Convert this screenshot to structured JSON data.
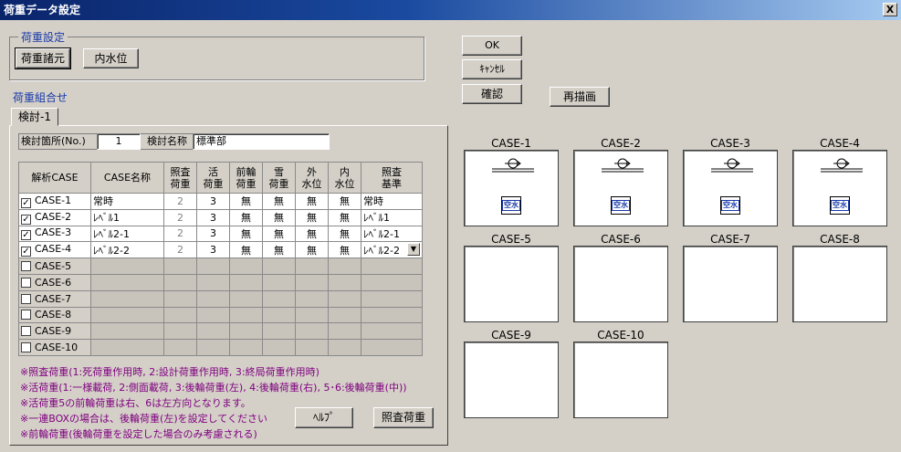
{
  "window": {
    "title": "荷重データ設定",
    "close_label": "X"
  },
  "load_settings": {
    "group_label": "荷重設定",
    "load_specs_button": "荷重諸元",
    "inner_water_button": "内水位"
  },
  "actions": {
    "ok": "OK",
    "cancel": "ｷｬﾝｾﾙ",
    "confirm": "確認",
    "redraw": "再描画",
    "help": "ﾍﾙﾌﾟ",
    "check_load": "照査荷重"
  },
  "combo_label": "荷重組合せ",
  "tab": {
    "label": "検討-1"
  },
  "location": {
    "label": "検討箇所(No.)",
    "value": "1",
    "name_label": "検討名称",
    "name_value": "標準部"
  },
  "grid": {
    "headers": [
      "解析CASE",
      "CASE名称",
      "照査\n荷重",
      "活\n荷重",
      "前輪\n荷重",
      "雪\n荷重",
      "外\n水位",
      "内\n水位",
      "照査\n基準"
    ],
    "rows": [
      {
        "checked": "✓",
        "case": "CASE-1",
        "name": "常時",
        "check_load": "2",
        "live": "3",
        "front": "無",
        "snow": "無",
        "outer": "無",
        "inner": "無",
        "criteria": "常時"
      },
      {
        "checked": "✓",
        "case": "CASE-2",
        "name": "ﾚﾍﾞﾙ1",
        "check_load": "2",
        "live": "3",
        "front": "無",
        "snow": "無",
        "outer": "無",
        "inner": "無",
        "criteria": "ﾚﾍﾞﾙ1"
      },
      {
        "checked": "✓",
        "case": "CASE-3",
        "name": "ﾚﾍﾞﾙ2-1",
        "check_load": "2",
        "live": "3",
        "front": "無",
        "snow": "無",
        "outer": "無",
        "inner": "無",
        "criteria": "ﾚﾍﾞﾙ2-1"
      },
      {
        "checked": "✓",
        "case": "CASE-4",
        "name": "ﾚﾍﾞﾙ2-2",
        "check_load": "2",
        "live": "3",
        "front": "無",
        "snow": "無",
        "outer": "無",
        "inner": "無",
        "criteria": "ﾚﾍﾞﾙ2-2"
      },
      {
        "checked": "",
        "case": "CASE-5"
      },
      {
        "checked": "",
        "case": "CASE-6"
      },
      {
        "checked": "",
        "case": "CASE-7"
      },
      {
        "checked": "",
        "case": "CASE-8"
      },
      {
        "checked": "",
        "case": "CASE-9"
      },
      {
        "checked": "",
        "case": "CASE-10"
      }
    ]
  },
  "notes": [
    "※照査荷重(1:死荷重作用時, 2:設計荷重作用時, 3:終局荷重作用時)",
    "※活荷重(1:一様載荷, 2:側面載荷, 3:後輪荷重(左), 4:後輪荷重(右), 5･6:後輪荷重(中))",
    "※活荷重5の前輪荷重は右、6は左方向となります。",
    "※一連BOXの場合は、後輪荷重(左)を設定してください",
    "※前輪荷重(後輪荷重を設定した場合のみ考慮される)"
  ],
  "previews": [
    {
      "label": "CASE-1",
      "badge": "空水"
    },
    {
      "label": "CASE-2",
      "badge": "空水"
    },
    {
      "label": "CASE-3",
      "badge": "空水"
    },
    {
      "label": "CASE-4",
      "badge": "空水"
    },
    {
      "label": "CASE-5",
      "badge": ""
    },
    {
      "label": "CASE-6",
      "badge": ""
    },
    {
      "label": "CASE-7",
      "badge": ""
    },
    {
      "label": "CASE-8",
      "badge": ""
    },
    {
      "label": "CASE-9",
      "badge": ""
    },
    {
      "label": "CASE-10",
      "badge": ""
    }
  ],
  "icons": {
    "close": "close-icon",
    "dropdown": "chevron-down-icon",
    "load_arrow": "rotation-arrow-icon"
  },
  "colors": {
    "title_bar": "#0a246a",
    "label_blue": "#1a3aa8",
    "note_purple": "#800080",
    "badge_blue": "#1a3aa8"
  }
}
